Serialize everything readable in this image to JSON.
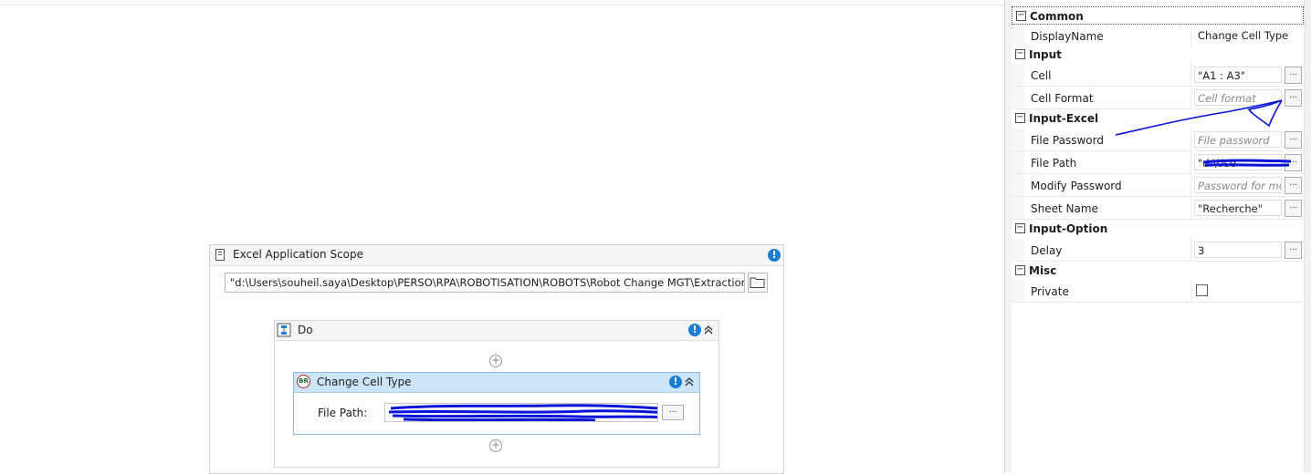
{
  "excel_scope": {
    "title": "Excel Application Scope",
    "workbook_path": "\"d:\\Users\\souheil.saya\\Desktop\\PERSO\\RPA\\ROBOTISATION\\ROBOTS\\Robot Change MGT\\Extraction.xlsx\"",
    "browse_icon": "folder-icon"
  },
  "do_sequence": {
    "title": "Do"
  },
  "change_cell_type": {
    "title": "Change Cell Type",
    "badge": "BR",
    "file_path_label": "File Path:",
    "file_path_value": "",
    "browse_label": "..."
  },
  "properties": {
    "categories": {
      "common": "Common",
      "input": "Input",
      "input_excel": "Input-Excel",
      "input_option": "Input-Option",
      "misc": "Misc"
    },
    "display_name": {
      "label": "DisplayName",
      "value": "Change Cell Type"
    },
    "cell": {
      "label": "Cell",
      "value": "\"A1 : A3\""
    },
    "cell_format": {
      "label": "Cell Format",
      "placeholder": "Cell format"
    },
    "file_password": {
      "label": "File Password",
      "placeholder": "File password"
    },
    "file_path": {
      "label": "File Path",
      "value": "\"d:\\Use"
    },
    "modify_password": {
      "label": "Modify Password",
      "placeholder": "Password for mod"
    },
    "sheet_name": {
      "label": "Sheet Name",
      "value": "\"Recherche\""
    },
    "delay": {
      "label": "Delay",
      "value": "3"
    },
    "private": {
      "label": "Private",
      "checked": false
    },
    "ellipsis": "...",
    "collapse_glyph": "−"
  },
  "colors": {
    "accent": "#1a7fd4",
    "selected_header": "#cce4f7",
    "annotation_ink": "#0a14d8"
  }
}
